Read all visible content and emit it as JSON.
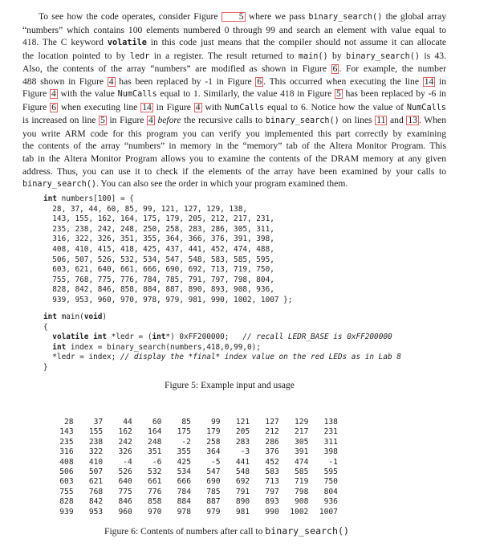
{
  "paragraph": {
    "lines": [
      [
        {
          "t": "To see how the code operates, consider Figure "
        },
        {
          "ref": "5"
        },
        {
          "t": " where we pass "
        },
        {
          "code": "binary_search()"
        },
        {
          "t": " the global array"
        }
      ],
      [
        {
          "t": "“numbers” which contains 100 elements numbered 0 through 99 and search an element with value equal to"
        }
      ],
      [
        {
          "t": "418. The C keyword "
        },
        {
          "codeb": "volatile"
        },
        {
          "t": " in this code just means that the compiler should not assume it can allocate"
        }
      ],
      [
        {
          "t": "the location pointed to by "
        },
        {
          "code": "ledr"
        },
        {
          "t": " in a register.  The result returned to "
        },
        {
          "code": "main()"
        },
        {
          "t": " by "
        },
        {
          "code": "binary_search()"
        },
        {
          "t": " is 43."
        }
      ],
      [
        {
          "t": "Also, the contents of the array “numbers” are modified as shown in Figure "
        },
        {
          "ref": "6"
        },
        {
          "t": ".  For example, the number"
        }
      ],
      [
        {
          "t": "488 shown in Figure "
        },
        {
          "ref": "4"
        },
        {
          "t": " has been replaced by -1 in Figure "
        },
        {
          "ref": "6"
        },
        {
          "t": ".  This occurred when executing the line "
        },
        {
          "ref": "14"
        },
        {
          "t": " in"
        }
      ],
      [
        {
          "t": "Figure "
        },
        {
          "ref": "4"
        },
        {
          "t": " with the value "
        },
        {
          "code": "NumCalls"
        },
        {
          "t": " equal to 1. Similarly, the value 418 in Figure "
        },
        {
          "ref": "5"
        },
        {
          "t": " has been replaced by -6 in"
        }
      ],
      [
        {
          "t": "Figure "
        },
        {
          "ref": "6"
        },
        {
          "t": " when executing line "
        },
        {
          "ref": "14"
        },
        {
          "t": " in Figure "
        },
        {
          "ref": "4"
        },
        {
          "t": " with "
        },
        {
          "code": "NumCalls"
        },
        {
          "t": " equal to 6. Notice how the value of "
        },
        {
          "code": "NumCalls"
        }
      ],
      [
        {
          "t": "is increased on line "
        },
        {
          "ref": "5"
        },
        {
          "t": " in Figure "
        },
        {
          "ref": "4"
        },
        {
          "t": " "
        },
        {
          "em": "before"
        },
        {
          "t": " the recursive calls to "
        },
        {
          "code": "binary_search()"
        },
        {
          "t": " on lines "
        },
        {
          "ref": "11"
        },
        {
          "t": " and "
        },
        {
          "ref": "13"
        },
        {
          "t": ". When"
        }
      ],
      [
        {
          "t": "you write ARM code for this program you can verify you implemented this part correctly by examining"
        }
      ],
      [
        {
          "t": "the contents of the array “numbers” in memory in the “memory” tab of the Altera Monitor Program.  This"
        }
      ],
      [
        {
          "t": "tab in the Altera Monitor Program allows you to examine the contents of the DRAM memory at any given"
        }
      ],
      [
        {
          "t": "address.  Thus, you can use it to check if the elements of the array have been examined by your calls to"
        }
      ],
      [
        {
          "code": "binary_search()"
        },
        {
          "t": ". You can also see the order in which your program examined them."
        }
      ]
    ]
  },
  "figure5": {
    "code_lines": [
      [
        {
          "kw": "int"
        },
        {
          "t": " numbers[100] = {"
        }
      ],
      [
        {
          "t": "  28, 37, 44, 60, 85, 99, 121, 127, 129, 138,"
        }
      ],
      [
        {
          "t": "  143, 155, 162, 164, 175, 179, 205, 212, 217, 231,"
        }
      ],
      [
        {
          "t": "  235, 238, 242, 248, 250, 258, 283, 286, 305, 311,"
        }
      ],
      [
        {
          "t": "  316, 322, 326, 351, 355, 364, 366, 376, 391, 398,"
        }
      ],
      [
        {
          "t": "  408, 410, 415, 418, 425, 437, 441, 452, 474, 488,"
        }
      ],
      [
        {
          "t": "  506, 507, 526, 532, 534, 547, 548, 583, 585, 595,"
        }
      ],
      [
        {
          "t": "  603, 621, 640, 661, 666, 690, 692, 713, 719, 750,"
        }
      ],
      [
        {
          "t": "  755, 768, 775, 776, 784, 785, 791, 797, 798, 804,"
        }
      ],
      [
        {
          "t": "  828, 842, 846, 858, 884, 887, 890, 893, 908, 936,"
        }
      ],
      [
        {
          "t": "  939, 953, 960, 970, 978, 979, 981, 990, 1002, 1007 };"
        }
      ]
    ],
    "main_lines": [
      [
        {
          "kw": "int"
        },
        {
          "t": " main("
        },
        {
          "kw": "void"
        },
        {
          "t": ")"
        }
      ],
      [
        {
          "t": "{"
        }
      ],
      [
        {
          "t": "  "
        },
        {
          "kw": "volatile int"
        },
        {
          "t": " *ledr = ("
        },
        {
          "kw": "int"
        },
        {
          "t": "*) 0xFF200000;   "
        },
        {
          "cm": "// recall LEDR_BASE is 0xFF200000"
        }
      ],
      [
        {
          "t": "  "
        },
        {
          "kw": "int"
        },
        {
          "t": " index = binary_search(numbers,418,0,99,0);"
        }
      ],
      [
        {
          "t": "  *ledr = index; "
        },
        {
          "cm": "// display the *final* index value on the red LEDs as in Lab 8"
        }
      ],
      [
        {
          "t": "}"
        }
      ]
    ],
    "caption": "Figure 5: Example input and usage"
  },
  "figure6": {
    "table": [
      [
        "28",
        "37",
        "44",
        "60",
        "85",
        "99",
        "121",
        "127",
        "129",
        "138"
      ],
      [
        "143",
        "155",
        "162",
        "164",
        "175",
        "179",
        "205",
        "212",
        "217",
        "231"
      ],
      [
        "235",
        "238",
        "242",
        "248",
        "-2",
        "258",
        "283",
        "286",
        "305",
        "311"
      ],
      [
        "316",
        "322",
        "326",
        "351",
        "355",
        "364",
        "-3",
        "376",
        "391",
        "398"
      ],
      [
        "408",
        "410",
        "-4",
        "-6",
        "425",
        "-5",
        "441",
        "452",
        "474",
        "-1"
      ],
      [
        "506",
        "507",
        "526",
        "532",
        "534",
        "547",
        "548",
        "583",
        "585",
        "595"
      ],
      [
        "603",
        "621",
        "640",
        "661",
        "666",
        "690",
        "692",
        "713",
        "719",
        "750"
      ],
      [
        "755",
        "768",
        "775",
        "776",
        "784",
        "785",
        "791",
        "797",
        "798",
        "804"
      ],
      [
        "828",
        "842",
        "846",
        "858",
        "884",
        "887",
        "890",
        "893",
        "908",
        "936"
      ],
      [
        "939",
        "953",
        "960",
        "970",
        "978",
        "979",
        "981",
        "990",
        "1002",
        "1007"
      ]
    ],
    "caption_text": "Figure 6: Contents of numbers after call to ",
    "caption_code": "binary_search()"
  },
  "colors": {
    "reference_box": "#e06060",
    "text": "#1a1a1a"
  }
}
